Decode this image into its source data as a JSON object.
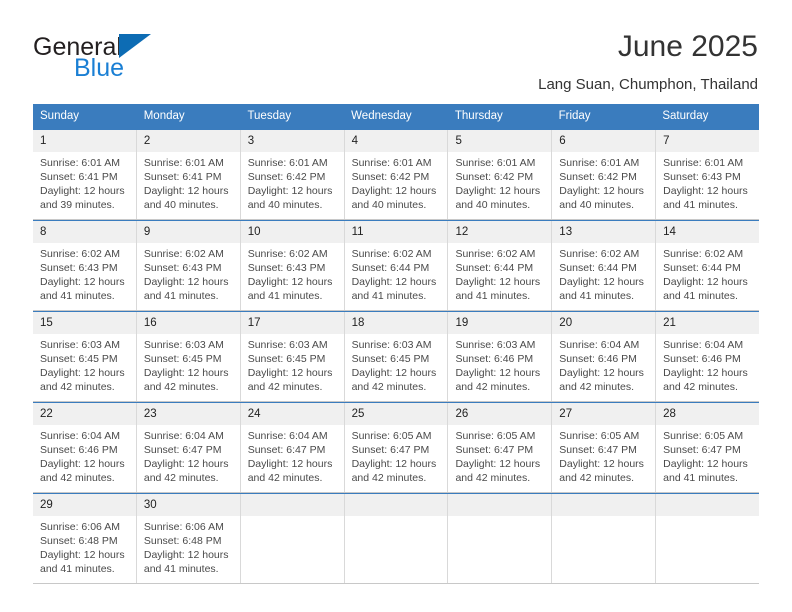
{
  "brand": {
    "line1": "General",
    "line2": "Blue",
    "triangle_color": "#0d6cb4",
    "line2_color": "#1a7fd4"
  },
  "header": {
    "title": "June 2025",
    "subtitle": "Lang Suan, Chumphon, Thailand"
  },
  "theme": {
    "header_row_bg": "#3a7cbe",
    "header_row_text": "#ffffff",
    "day_number_bg": "#f0f0f0",
    "cell_border": "#d9d9d9",
    "week_divider": "#3a7cbe"
  },
  "weekdays": [
    "Sunday",
    "Monday",
    "Tuesday",
    "Wednesday",
    "Thursday",
    "Friday",
    "Saturday"
  ],
  "labels": {
    "sunrise_prefix": "Sunrise:",
    "sunset_prefix": "Sunset:",
    "daylight_prefix": "Daylight:"
  },
  "weeks": [
    [
      {
        "day": "1",
        "sunrise": "Sunrise: 6:01 AM",
        "sunset": "Sunset: 6:41 PM",
        "daylight1": "Daylight: 12 hours",
        "daylight2": "and 39 minutes."
      },
      {
        "day": "2",
        "sunrise": "Sunrise: 6:01 AM",
        "sunset": "Sunset: 6:41 PM",
        "daylight1": "Daylight: 12 hours",
        "daylight2": "and 40 minutes."
      },
      {
        "day": "3",
        "sunrise": "Sunrise: 6:01 AM",
        "sunset": "Sunset: 6:42 PM",
        "daylight1": "Daylight: 12 hours",
        "daylight2": "and 40 minutes."
      },
      {
        "day": "4",
        "sunrise": "Sunrise: 6:01 AM",
        "sunset": "Sunset: 6:42 PM",
        "daylight1": "Daylight: 12 hours",
        "daylight2": "and 40 minutes."
      },
      {
        "day": "5",
        "sunrise": "Sunrise: 6:01 AM",
        "sunset": "Sunset: 6:42 PM",
        "daylight1": "Daylight: 12 hours",
        "daylight2": "and 40 minutes."
      },
      {
        "day": "6",
        "sunrise": "Sunrise: 6:01 AM",
        "sunset": "Sunset: 6:42 PM",
        "daylight1": "Daylight: 12 hours",
        "daylight2": "and 40 minutes."
      },
      {
        "day": "7",
        "sunrise": "Sunrise: 6:01 AM",
        "sunset": "Sunset: 6:43 PM",
        "daylight1": "Daylight: 12 hours",
        "daylight2": "and 41 minutes."
      }
    ],
    [
      {
        "day": "8",
        "sunrise": "Sunrise: 6:02 AM",
        "sunset": "Sunset: 6:43 PM",
        "daylight1": "Daylight: 12 hours",
        "daylight2": "and 41 minutes."
      },
      {
        "day": "9",
        "sunrise": "Sunrise: 6:02 AM",
        "sunset": "Sunset: 6:43 PM",
        "daylight1": "Daylight: 12 hours",
        "daylight2": "and 41 minutes."
      },
      {
        "day": "10",
        "sunrise": "Sunrise: 6:02 AM",
        "sunset": "Sunset: 6:43 PM",
        "daylight1": "Daylight: 12 hours",
        "daylight2": "and 41 minutes."
      },
      {
        "day": "11",
        "sunrise": "Sunrise: 6:02 AM",
        "sunset": "Sunset: 6:44 PM",
        "daylight1": "Daylight: 12 hours",
        "daylight2": "and 41 minutes."
      },
      {
        "day": "12",
        "sunrise": "Sunrise: 6:02 AM",
        "sunset": "Sunset: 6:44 PM",
        "daylight1": "Daylight: 12 hours",
        "daylight2": "and 41 minutes."
      },
      {
        "day": "13",
        "sunrise": "Sunrise: 6:02 AM",
        "sunset": "Sunset: 6:44 PM",
        "daylight1": "Daylight: 12 hours",
        "daylight2": "and 41 minutes."
      },
      {
        "day": "14",
        "sunrise": "Sunrise: 6:02 AM",
        "sunset": "Sunset: 6:44 PM",
        "daylight1": "Daylight: 12 hours",
        "daylight2": "and 41 minutes."
      }
    ],
    [
      {
        "day": "15",
        "sunrise": "Sunrise: 6:03 AM",
        "sunset": "Sunset: 6:45 PM",
        "daylight1": "Daylight: 12 hours",
        "daylight2": "and 42 minutes."
      },
      {
        "day": "16",
        "sunrise": "Sunrise: 6:03 AM",
        "sunset": "Sunset: 6:45 PM",
        "daylight1": "Daylight: 12 hours",
        "daylight2": "and 42 minutes."
      },
      {
        "day": "17",
        "sunrise": "Sunrise: 6:03 AM",
        "sunset": "Sunset: 6:45 PM",
        "daylight1": "Daylight: 12 hours",
        "daylight2": "and 42 minutes."
      },
      {
        "day": "18",
        "sunrise": "Sunrise: 6:03 AM",
        "sunset": "Sunset: 6:45 PM",
        "daylight1": "Daylight: 12 hours",
        "daylight2": "and 42 minutes."
      },
      {
        "day": "19",
        "sunrise": "Sunrise: 6:03 AM",
        "sunset": "Sunset: 6:46 PM",
        "daylight1": "Daylight: 12 hours",
        "daylight2": "and 42 minutes."
      },
      {
        "day": "20",
        "sunrise": "Sunrise: 6:04 AM",
        "sunset": "Sunset: 6:46 PM",
        "daylight1": "Daylight: 12 hours",
        "daylight2": "and 42 minutes."
      },
      {
        "day": "21",
        "sunrise": "Sunrise: 6:04 AM",
        "sunset": "Sunset: 6:46 PM",
        "daylight1": "Daylight: 12 hours",
        "daylight2": "and 42 minutes."
      }
    ],
    [
      {
        "day": "22",
        "sunrise": "Sunrise: 6:04 AM",
        "sunset": "Sunset: 6:46 PM",
        "daylight1": "Daylight: 12 hours",
        "daylight2": "and 42 minutes."
      },
      {
        "day": "23",
        "sunrise": "Sunrise: 6:04 AM",
        "sunset": "Sunset: 6:47 PM",
        "daylight1": "Daylight: 12 hours",
        "daylight2": "and 42 minutes."
      },
      {
        "day": "24",
        "sunrise": "Sunrise: 6:04 AM",
        "sunset": "Sunset: 6:47 PM",
        "daylight1": "Daylight: 12 hours",
        "daylight2": "and 42 minutes."
      },
      {
        "day": "25",
        "sunrise": "Sunrise: 6:05 AM",
        "sunset": "Sunset: 6:47 PM",
        "daylight1": "Daylight: 12 hours",
        "daylight2": "and 42 minutes."
      },
      {
        "day": "26",
        "sunrise": "Sunrise: 6:05 AM",
        "sunset": "Sunset: 6:47 PM",
        "daylight1": "Daylight: 12 hours",
        "daylight2": "and 42 minutes."
      },
      {
        "day": "27",
        "sunrise": "Sunrise: 6:05 AM",
        "sunset": "Sunset: 6:47 PM",
        "daylight1": "Daylight: 12 hours",
        "daylight2": "and 42 minutes."
      },
      {
        "day": "28",
        "sunrise": "Sunrise: 6:05 AM",
        "sunset": "Sunset: 6:47 PM",
        "daylight1": "Daylight: 12 hours",
        "daylight2": "and 41 minutes."
      }
    ],
    [
      {
        "day": "29",
        "sunrise": "Sunrise: 6:06 AM",
        "sunset": "Sunset: 6:48 PM",
        "daylight1": "Daylight: 12 hours",
        "daylight2": "and 41 minutes."
      },
      {
        "day": "30",
        "sunrise": "Sunrise: 6:06 AM",
        "sunset": "Sunset: 6:48 PM",
        "daylight1": "Daylight: 12 hours",
        "daylight2": "and 41 minutes."
      },
      {
        "day": "",
        "sunrise": "",
        "sunset": "",
        "daylight1": "",
        "daylight2": ""
      },
      {
        "day": "",
        "sunrise": "",
        "sunset": "",
        "daylight1": "",
        "daylight2": ""
      },
      {
        "day": "",
        "sunrise": "",
        "sunset": "",
        "daylight1": "",
        "daylight2": ""
      },
      {
        "day": "",
        "sunrise": "",
        "sunset": "",
        "daylight1": "",
        "daylight2": ""
      },
      {
        "day": "",
        "sunrise": "",
        "sunset": "",
        "daylight1": "",
        "daylight2": ""
      }
    ]
  ]
}
